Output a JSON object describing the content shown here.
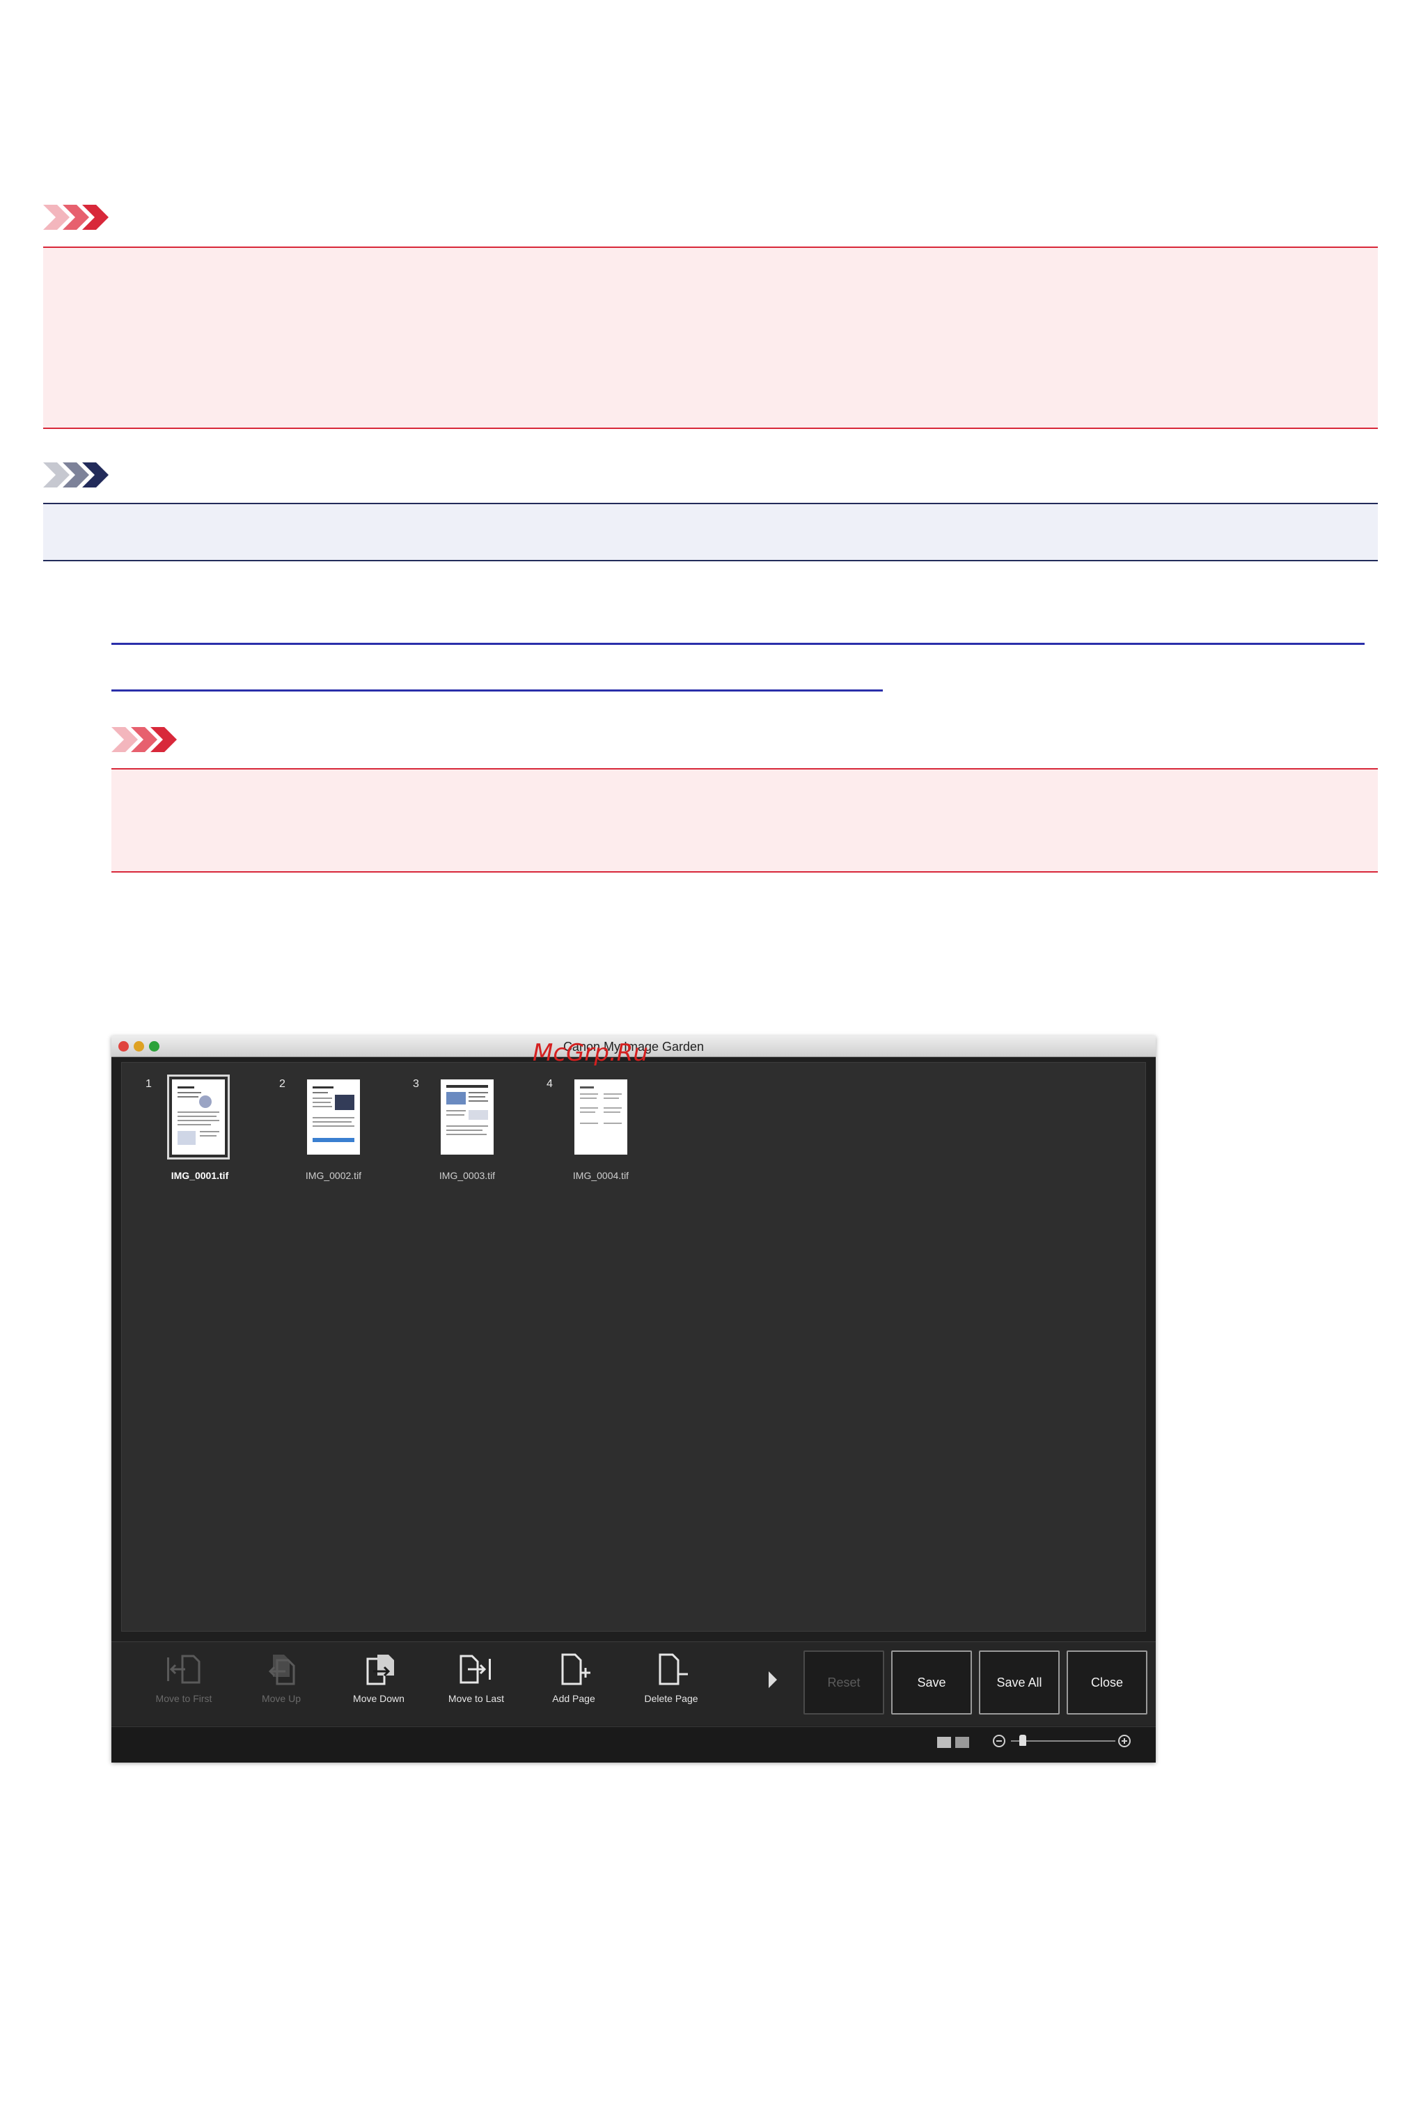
{
  "window": {
    "title": "Canon My Image Garden"
  },
  "watermark": "McGrp.Ru",
  "thumbnails": [
    {
      "number": "1",
      "filename": "IMG_0001.tif",
      "selected": true
    },
    {
      "number": "2",
      "filename": "IMG_0002.tif",
      "selected": false
    },
    {
      "number": "3",
      "filename": "IMG_0003.tif",
      "selected": false
    },
    {
      "number": "4",
      "filename": "IMG_0004.tif",
      "selected": false
    }
  ],
  "toolbar": {
    "move_to_first": "Move to First",
    "move_up": "Move Up",
    "move_down": "Move Down",
    "move_to_last": "Move to Last",
    "add_page": "Add Page",
    "delete_page": "Delete Page",
    "reset": "Reset",
    "save": "Save",
    "save_all": "Save All",
    "close": "Close"
  },
  "colors": {
    "important": "#d8283a",
    "note": "#222b5a",
    "link": "#2a2faa"
  },
  "icons": {
    "important": "important-chevrons-icon",
    "note": "note-chevrons-icon"
  }
}
